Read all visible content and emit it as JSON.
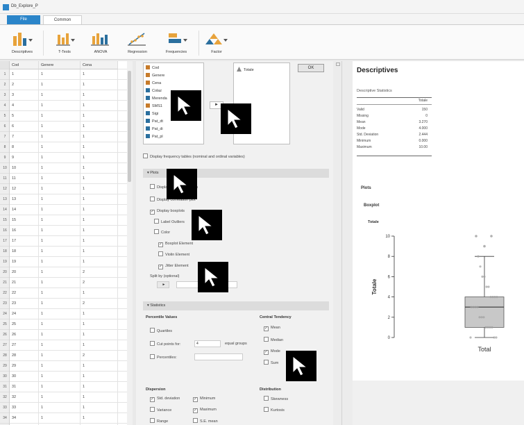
{
  "window": {
    "title": "Db_Explore_P"
  },
  "menu": {
    "file": "File",
    "common": "Common"
  },
  "ribbon": [
    {
      "label": "Descriptives",
      "icon": "descriptives-icon"
    },
    {
      "label": "T-Tests",
      "icon": "t-tests-icon"
    },
    {
      "label": "ANOVA",
      "icon": "anova-icon"
    },
    {
      "label": "Regression",
      "icon": "regression-icon"
    },
    {
      "label": "Frequencies",
      "icon": "frequencies-icon"
    },
    {
      "label": "Factor",
      "icon": "factor-icon"
    }
  ],
  "grid": {
    "columns": [
      "Cod",
      "Genere",
      "Cena"
    ],
    "rows": [
      [
        "1",
        "1",
        "1",
        "1"
      ],
      [
        "2",
        "2",
        "1",
        "1"
      ],
      [
        "3",
        "3",
        "1",
        "1"
      ],
      [
        "4",
        "4",
        "1",
        "1"
      ],
      [
        "5",
        "5",
        "1",
        "1"
      ],
      [
        "6",
        "6",
        "1",
        "1"
      ],
      [
        "7",
        "7",
        "1",
        "1"
      ],
      [
        "8",
        "8",
        "1",
        "1"
      ],
      [
        "9",
        "9",
        "1",
        "1"
      ],
      [
        "10",
        "10",
        "1",
        "1"
      ],
      [
        "11",
        "11",
        "1",
        "1"
      ],
      [
        "12",
        "12",
        "1",
        "1"
      ],
      [
        "13",
        "13",
        "1",
        "1"
      ],
      [
        "14",
        "14",
        "1",
        "1"
      ],
      [
        "15",
        "15",
        "1",
        "1"
      ],
      [
        "16",
        "16",
        "1",
        "1"
      ],
      [
        "17",
        "17",
        "1",
        "1"
      ],
      [
        "18",
        "18",
        "1",
        "1"
      ],
      [
        "19",
        "19",
        "1",
        "1"
      ],
      [
        "20",
        "20",
        "1",
        "2"
      ],
      [
        "21",
        "21",
        "1",
        "2"
      ],
      [
        "22",
        "22",
        "1",
        "1"
      ],
      [
        "23",
        "23",
        "1",
        "2"
      ],
      [
        "24",
        "24",
        "1",
        "1"
      ],
      [
        "25",
        "25",
        "1",
        "1"
      ],
      [
        "26",
        "26",
        "1",
        "1"
      ],
      [
        "27",
        "27",
        "1",
        "1"
      ],
      [
        "28",
        "28",
        "1",
        "2"
      ],
      [
        "29",
        "29",
        "1",
        "1"
      ],
      [
        "30",
        "30",
        "1",
        "1"
      ],
      [
        "31",
        "31",
        "1",
        "1"
      ],
      [
        "32",
        "32",
        "1",
        "1"
      ],
      [
        "33",
        "33",
        "1",
        "1"
      ],
      [
        "34",
        "34",
        "1",
        "1"
      ],
      [
        "35",
        "35",
        "1",
        "1"
      ]
    ]
  },
  "options": {
    "variables": [
      "Cod",
      "Genere",
      "Cena",
      "Colaz",
      "Merenda",
      "SMS1",
      "Sigi",
      "Pat_dt",
      "Pat_di",
      "Pat_pl"
    ],
    "move_button": "►",
    "target_variables": [
      "Totale"
    ],
    "ok_button": "OK",
    "freq_tables_label": "Display frequency tables (nominal and ordinal variables)",
    "plots_section": "Plots",
    "plots_options": [
      {
        "label": "Display distribution plots",
        "checked": false
      },
      {
        "label": "Display correlation plot",
        "checked": false
      },
      {
        "label": "Display boxplots",
        "checked": true
      },
      {
        "label": "Label Outliers",
        "checked": false
      },
      {
        "label": "Color",
        "checked": false
      },
      {
        "label": "Boxplot Element",
        "checked": true
      },
      {
        "label": "Violin Element",
        "checked": false
      },
      {
        "label": "Jitter Element",
        "checked": true
      }
    ],
    "split_label": "Split by (optional)",
    "statistics_section": "Statistics",
    "percentile_head": "Percentile Values",
    "percentile_options": [
      {
        "label": "Quartiles",
        "checked": false
      },
      {
        "label": "Cut points for:",
        "checked": false
      },
      {
        "label": "Percentiles:",
        "checked": false
      }
    ],
    "cut_points_value": "4",
    "cut_points_suffix": "equal groups",
    "central_head": "Central Tendency",
    "central_options": [
      {
        "label": "Mean",
        "checked": true
      },
      {
        "label": "Median",
        "checked": false
      },
      {
        "label": "Mode",
        "checked": true
      },
      {
        "label": "Sum",
        "checked": false
      }
    ],
    "dispersion_head": "Dispersion",
    "dispersion_options": [
      {
        "label": "Std. deviation",
        "checked": true
      },
      {
        "label": "Minimum",
        "checked": true
      },
      {
        "label": "Variance",
        "checked": false
      },
      {
        "label": "Maximum",
        "checked": true
      },
      {
        "label": "Range",
        "checked": false
      },
      {
        "label": "S.E. mean",
        "checked": false
      }
    ],
    "distribution_head": "Distribution",
    "distribution_options": [
      {
        "label": "Skewness",
        "checked": false
      },
      {
        "label": "Kurtosis",
        "checked": false
      }
    ]
  },
  "output": {
    "title": "Descriptives",
    "stats_caption": "Descriptive Statistics",
    "column": "Totale",
    "stats": [
      {
        "label": "Valid",
        "value": "150"
      },
      {
        "label": "Missing",
        "value": "0"
      },
      {
        "label": "Mean",
        "value": "3.270"
      },
      {
        "label": "Mode",
        "value": "4.000"
      },
      {
        "label": "Std. Deviation",
        "value": "2.444"
      },
      {
        "label": "Minimum",
        "value": "0.000"
      },
      {
        "label": "Maximum",
        "value": "10.00"
      }
    ],
    "plots_title": "Plots",
    "boxplot_title": "Boxplot",
    "plot_variable": "Totale"
  },
  "chart_data": {
    "type": "box",
    "ylabel": "Totale",
    "xlabel": "",
    "categories": [
      "Total"
    ],
    "yticks": [
      0,
      2,
      4,
      6,
      8,
      10
    ],
    "ylim": [
      0,
      10
    ],
    "box": {
      "min": 0,
      "q1": 1,
      "median": 3,
      "q3": 4,
      "max": 8
    },
    "outliers": [
      9,
      10,
      10
    ],
    "jitter_color": "#a0a0a0",
    "box_color": "#c8c8c8"
  }
}
